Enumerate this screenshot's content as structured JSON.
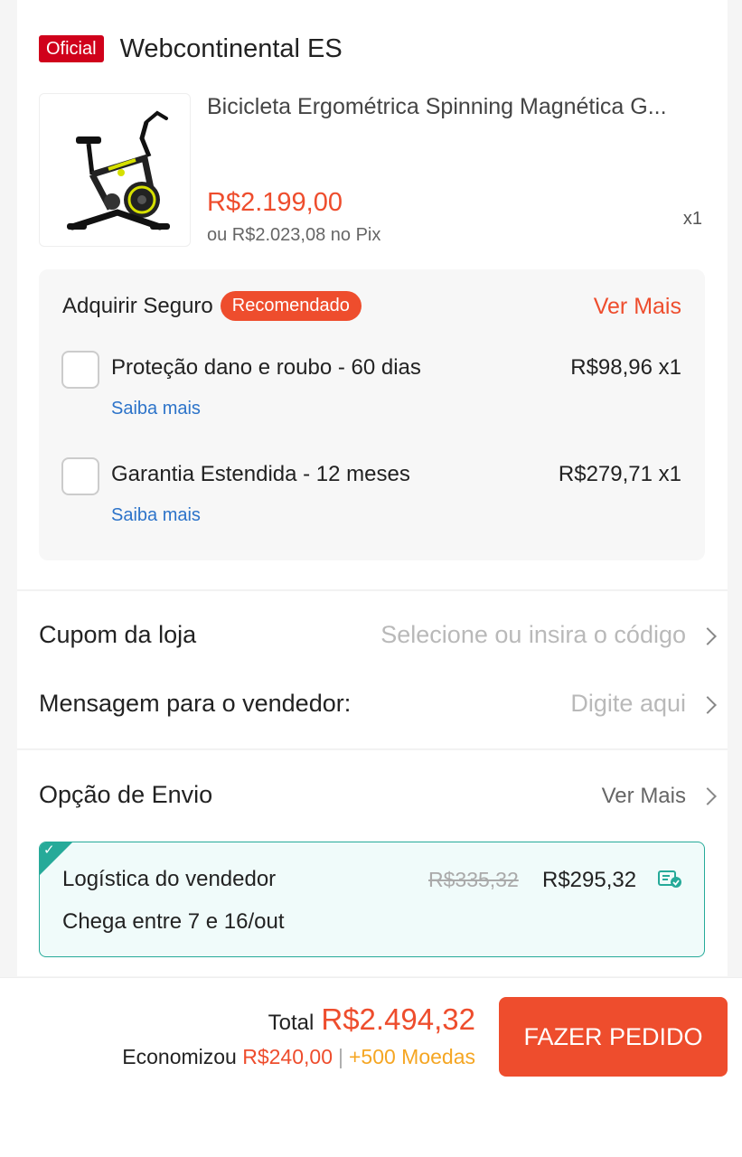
{
  "shop": {
    "badge": "Oficial",
    "name": "Webcontinental ES"
  },
  "product": {
    "title": "Bicicleta Ergométrica Spinning Magnética G...",
    "price": "R$2.199,00",
    "pix_price": "ou R$2.023,08 no Pix",
    "quantity": "x1",
    "image_icon": "exercise-bike-icon"
  },
  "insurance": {
    "title": "Adquirir Seguro",
    "badge": "Recomendado",
    "more": "Ver Mais",
    "items": [
      {
        "name": "Proteção dano e roubo - 60 dias",
        "price": "R$98,96 x1",
        "link": "Saiba mais",
        "checked": false
      },
      {
        "name": "Garantia Estendida - 12 meses",
        "price": "R$279,71 x1",
        "link": "Saiba mais",
        "checked": false
      }
    ]
  },
  "coupon": {
    "label": "Cupom da loja",
    "placeholder": "Selecione ou insira o código"
  },
  "message": {
    "label": "Mensagem para o vendedor:",
    "placeholder": "Digite aqui"
  },
  "shipping": {
    "label": "Opção de Envio",
    "more": "Ver Mais",
    "option": {
      "name": "Logística do vendedor",
      "old_price": "R$335,32",
      "price": "R$295,32",
      "eta": "Chega entre 7 e 16/out",
      "selected": true
    }
  },
  "footer": {
    "total_label": "Total",
    "total_value": "R$2.494,32",
    "saved_label": "Economizou",
    "saved_value": "R$240,00",
    "separator": "|",
    "coins": "+500 Moedas",
    "order_button": "FAZER PEDIDO"
  },
  "colors": {
    "accent": "#ee4d2d",
    "official_badge": "#d0011b",
    "link": "#2c73c9",
    "shipping_border": "#26aa99",
    "coins": "#f5a623"
  }
}
